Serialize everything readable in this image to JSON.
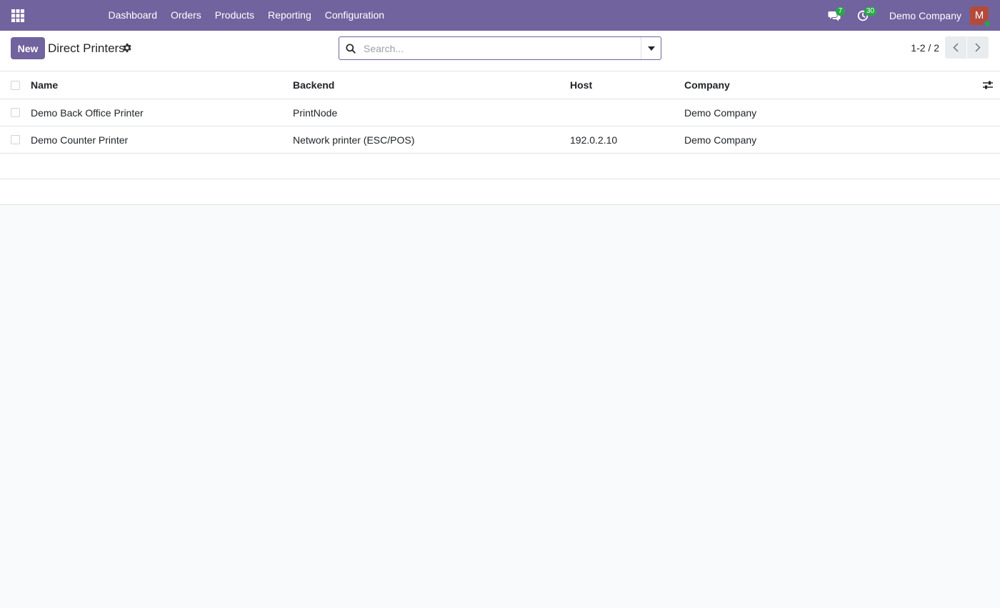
{
  "navbar": {
    "apps_icon": "grid-apps-icon",
    "menu": [
      "Dashboard",
      "Orders",
      "Products",
      "Reporting",
      "Configuration"
    ],
    "messages_badge": "7",
    "activities_badge": "30",
    "company": "Demo Company",
    "avatar_initial": "M",
    "colors": {
      "brand": "#71639e",
      "badge": "#28a745",
      "avatar": "#b34b3b"
    }
  },
  "control_panel": {
    "new_label": "New",
    "title": "Direct Printers",
    "search_placeholder": "Search...",
    "pager_value": "1-2 / 2"
  },
  "table": {
    "columns": [
      "Name",
      "Backend",
      "Host",
      "Company"
    ],
    "rows": [
      {
        "name": "Demo Back Office Printer",
        "backend": "PrintNode",
        "host": "",
        "company": "Demo Company"
      },
      {
        "name": "Demo Counter Printer",
        "backend": "Network printer (ESC/POS)",
        "host": "192.0.2.10",
        "company": "Demo Company"
      }
    ]
  }
}
